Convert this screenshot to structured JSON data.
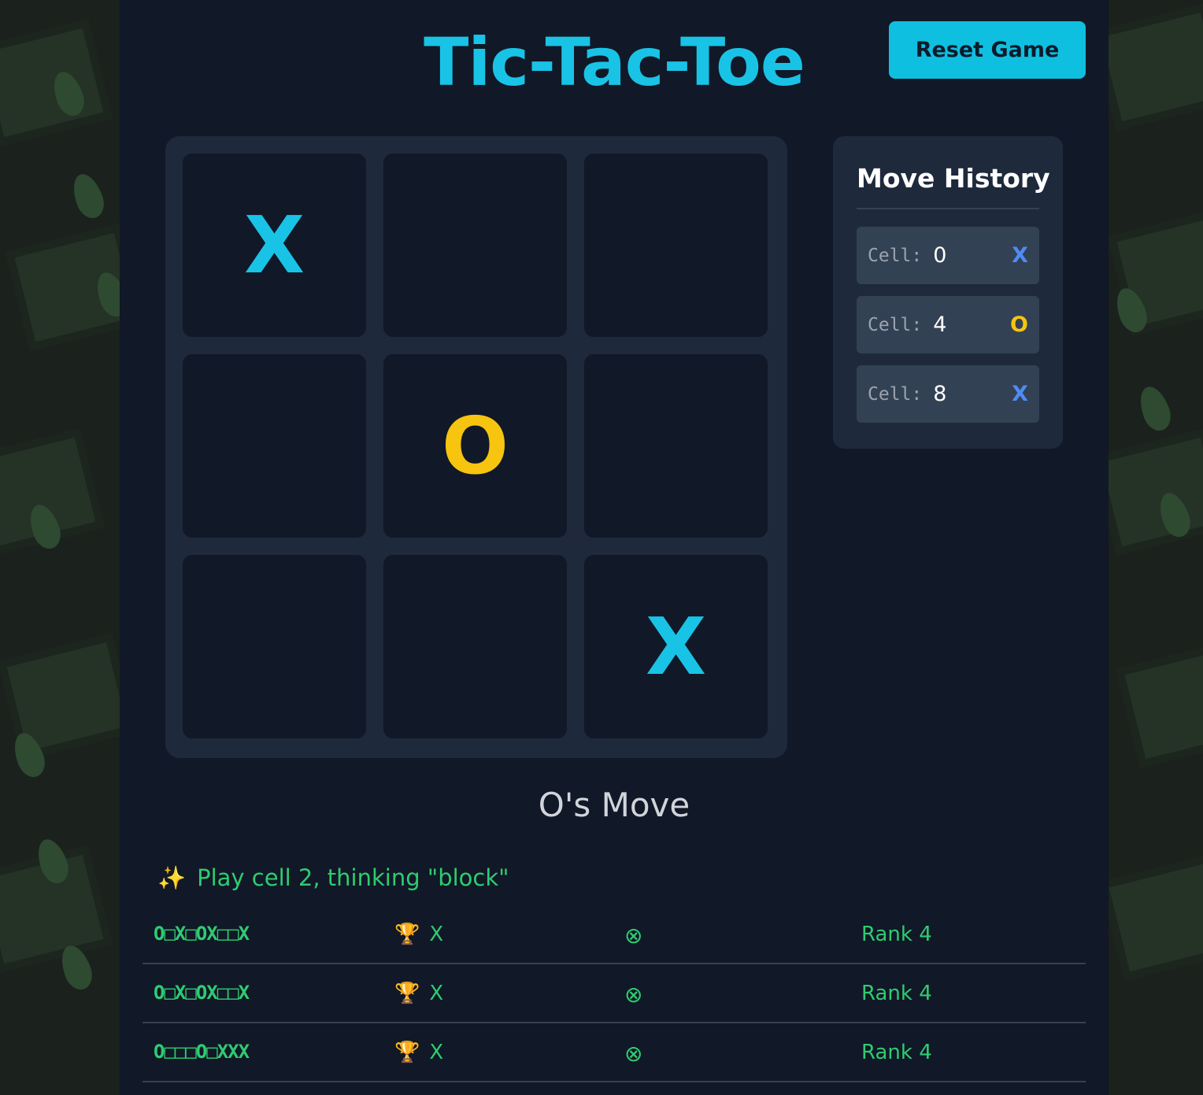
{
  "title": "Tic-Tac-Toe",
  "reset_label": "Reset Game",
  "board": {
    "cells": [
      "X",
      "",
      "",
      "",
      "O",
      "",
      "",
      "",
      "X"
    ]
  },
  "history": {
    "title": "Move History",
    "moves": [
      {
        "label": "Cell:",
        "cell": "0",
        "player": "X"
      },
      {
        "label": "Cell:",
        "cell": "4",
        "player": "O"
      },
      {
        "label": "Cell:",
        "cell": "8",
        "player": "X"
      }
    ]
  },
  "status": "O's Move",
  "hint": {
    "icon": "✨",
    "text": "Play cell 2, thinking \"block\""
  },
  "table_rows": [
    {
      "board": "O□X□OX□□X",
      "trophy": "🏆",
      "winner": "X",
      "result": "⊗",
      "rank": "Rank 4"
    },
    {
      "board": "O□X□OX□□X",
      "trophy": "🏆",
      "winner": "X",
      "result": "⊗",
      "rank": "Rank 4"
    },
    {
      "board": "O□□□O□XXX",
      "trophy": "🏆",
      "winner": "X",
      "result": "⊗",
      "rank": "Rank 4"
    }
  ],
  "colors": {
    "accent": "#19c3e6",
    "x_color": "#19c3e6",
    "o_color": "#f7c40f",
    "history_x": "#4e8cf5",
    "hint_green": "#2ecc71",
    "panel_bg": "#111827",
    "board_bg": "#1e293b"
  }
}
